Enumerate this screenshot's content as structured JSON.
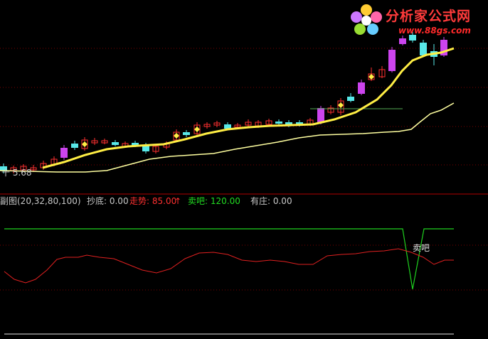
{
  "logo": {
    "name": "分析家公式网",
    "url": "www.88gs.com"
  },
  "main_panel": {
    "price_label": "十 5.68"
  },
  "indicator": {
    "title": "副图(20,32,80,100)",
    "chaodi": "抄底: 0.00",
    "zoushi": "走势: 85.00",
    "arrow": "↑",
    "maiba": "卖吧: 120.00",
    "youzhuang": "有庄: 0.00",
    "sell_annotation": "卖吧"
  },
  "colors": {
    "background": "#000000",
    "grid": "#7a0000",
    "divider": "#b00000",
    "yellow_line": "#ffee44",
    "pale_line": "#ffffa0",
    "candle_up": "#ff3030",
    "candle_cyan": "#58e8e8",
    "candle_purple": "#cc44ee",
    "green_line": "#1fd11f",
    "red_line": "#e02020",
    "legend_red": "#ff3030",
    "legend_green": "#22dd22"
  }
}
